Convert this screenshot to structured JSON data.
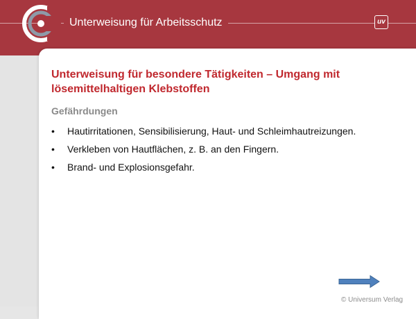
{
  "header": {
    "title": "Unterweisung für Arbeitsschutz",
    "badge": "uv",
    "brand_color": "#a7373f"
  },
  "slide": {
    "title": "Unterweisung für besondere Tätigkeiten – Umgang mit lösemittelhaltigen Klebstoffen",
    "subtitle": "Gefährdungen",
    "bullets": [
      "Hautirritationen, Sensibilisierung, Haut- und Schleimhautreizungen.",
      "Verkleben von Hautflächen, z. B. an den Fingern.",
      "Brand- und Explosionsgefahr."
    ],
    "title_color": "#c0282e"
  },
  "navigation": {
    "next_icon": "arrow-right-icon",
    "arrow_color": "#4f81bd"
  },
  "footer": {
    "copyright": "© Universum Verlag"
  }
}
